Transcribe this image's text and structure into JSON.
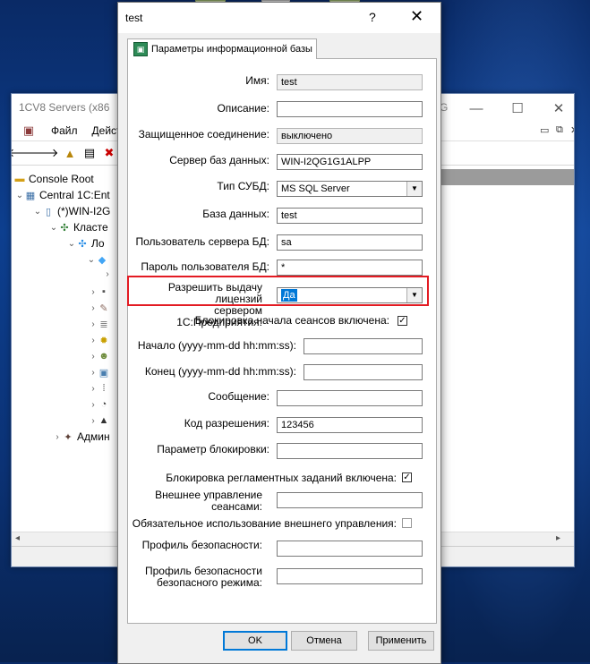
{
  "mmc": {
    "title": "1CV8 Servers (x86",
    "title_tail": "G",
    "menu": [
      "Файл",
      "Действ"
    ],
    "tree": [
      {
        "label": "Console Root",
        "icon": "folder-icon"
      },
      {
        "label": "Central 1C:Ent",
        "icon": "server-tree-icon"
      },
      {
        "label": "(*)WIN-I2G",
        "icon": "server-icon"
      },
      {
        "label": "Класте",
        "icon": "cluster-icon"
      },
      {
        "label": "Ло",
        "icon": "infobase-icon"
      },
      {
        "label": "Админ",
        "icon": "admin-icon"
      }
    ]
  },
  "dialog": {
    "title": "test",
    "help_glyph": "?",
    "close_glyph": "✕",
    "tab_label": "Параметры информационной базы",
    "fields": {
      "name": {
        "label": "Имя:",
        "value": "test"
      },
      "description": {
        "label": "Описание:",
        "value": ""
      },
      "secure_connection": {
        "label": "Защищенное соединение:",
        "value": "выключено"
      },
      "db_server": {
        "label": "Сервер баз данных:",
        "value": "WIN-I2QG1G1ALPP"
      },
      "dbms_type": {
        "label": "Тип СУБД:",
        "value": "MS SQL Server"
      },
      "database": {
        "label": "База данных:",
        "value": "test"
      },
      "db_user": {
        "label": "Пользователь сервера БД:",
        "value": "sa"
      },
      "db_password": {
        "label": "Пароль пользователя БД:",
        "value": "*"
      },
      "license_issue": {
        "label_line1": "Разрешить выдачу лицензий",
        "label_line2": "сервером 1С:Предприятия:",
        "value": "Да"
      },
      "session_lock": {
        "label": "Блокировка начала сеансов включена:",
        "checked": true
      },
      "start": {
        "label": "Начало (yyyy-mm-dd hh:mm:ss):",
        "value": ""
      },
      "end": {
        "label": "Конец (yyyy-mm-dd hh:mm:ss):",
        "value": ""
      },
      "message": {
        "label": "Сообщение:",
        "value": ""
      },
      "permission_code": {
        "label": "Код разрешения:",
        "value": "123456"
      },
      "lock_parameter": {
        "label": "Параметр блокировки:",
        "value": ""
      },
      "scheduled_jobs_lock": {
        "label": "Блокировка регламентных заданий включена:",
        "checked": true
      },
      "external_session_mgmt": {
        "label_line1": "Внешнее управление",
        "label_line2": "сеансами:",
        "value": ""
      },
      "external_mgmt_required": {
        "label": "Обязательное использование внешнего управления:",
        "checked": false
      },
      "security_profile": {
        "label": "Профиль безопасности:",
        "value": ""
      },
      "safe_mode_profile": {
        "label_line1": "Профиль безопасности",
        "label_line2": "безопасного режима:",
        "value": ""
      }
    },
    "buttons": {
      "ok": "OK",
      "cancel": "Отмена",
      "apply": "Применить"
    },
    "checkmark": "✓",
    "combo_arrow": "▼"
  },
  "colors": {
    "highlight": "#e31b23",
    "selection": "#0078d7"
  }
}
